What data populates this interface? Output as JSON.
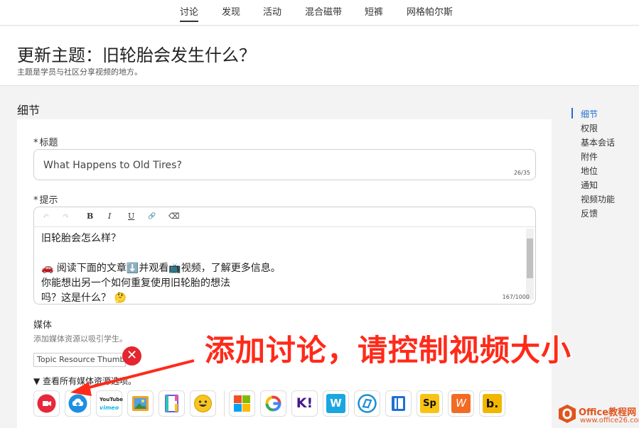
{
  "nav": {
    "tabs": [
      {
        "label": "讨论",
        "active": true
      },
      {
        "label": "发现",
        "active": false
      },
      {
        "label": "活动",
        "active": false
      },
      {
        "label": "混合磁带",
        "active": false
      },
      {
        "label": "短裤",
        "active": false
      },
      {
        "label": "网格帕尔斯",
        "active": false
      }
    ]
  },
  "header": {
    "title": "更新主题：旧轮胎会发生什么？",
    "subtitle": "主题是学员与社区分享视频的地方。"
  },
  "section": {
    "title": "细节"
  },
  "sidenav": {
    "items": [
      {
        "label": "细节",
        "active": true
      },
      {
        "label": "权限"
      },
      {
        "label": "基本会话"
      },
      {
        "label": "附件"
      },
      {
        "label": "地位"
      },
      {
        "label": "通知"
      },
      {
        "label": "视频功能"
      },
      {
        "label": "反馈"
      }
    ]
  },
  "form": {
    "title_label": "标题",
    "required_mark": "*",
    "title_value": "What Happens to Old Tires?",
    "title_count": "26/35",
    "prompt_label": "提示",
    "toolbar": {
      "undo": "↶",
      "redo": "↷",
      "bold": "B",
      "italic": "I",
      "underline": "U",
      "link": "🔗",
      "eraser": "⌫"
    },
    "prompt_lines": [
      "旧轮胎会怎么样？",
      "",
      "🚗 阅读下面的文章⬇️并观看📺视频，了解更多信息。",
      "你能想出另一个如何重复使用旧轮胎的想法",
      "吗？这是什么？ 🤔"
    ],
    "prompt_count": "167/1000",
    "media_label": "媒体",
    "media_hint": "添加媒体资源以吸引学生。",
    "thumbnail_alt": "Topic Resource Thumbnail",
    "remove_glyph": "✕",
    "view_all": "▼ 查看所有媒体资源选项。"
  },
  "media_tools": [
    {
      "name": "record",
      "icon": "record-icon",
      "color": "#e8273b"
    },
    {
      "name": "upload",
      "icon": "upload-cloud-icon",
      "color": "#1d8fe0"
    },
    {
      "name": "youtube-vimeo",
      "icon": "youtube-vimeo-icon",
      "text_top": "YouTube",
      "text_bottom": "vimeo"
    },
    {
      "name": "image",
      "icon": "image-icon",
      "color": "#f2a12c"
    },
    {
      "name": "document",
      "icon": "document-icon",
      "color": "#6b5bd6"
    },
    {
      "name": "emoji",
      "icon": "emoji-icon",
      "color": "#f7c51e"
    },
    {
      "name": "microsoft",
      "icon": "microsoft-icon"
    },
    {
      "name": "google",
      "icon": "google-icon"
    },
    {
      "name": "kahoot",
      "icon": "kahoot-icon",
      "text": "K!",
      "color": "#46178f"
    },
    {
      "name": "wakelet",
      "icon": "wakelet-icon",
      "text": "W",
      "color": "#1aa7e0"
    },
    {
      "name": "nearpod",
      "icon": "nearpod-icon",
      "color": "#1b8ed6"
    },
    {
      "name": "book-creator",
      "icon": "book-icon",
      "color": "#1f6fd1"
    },
    {
      "name": "adobe-spark",
      "icon": "spark-icon",
      "text": "Sp",
      "color": "#f9c313"
    },
    {
      "name": "wevideo",
      "icon": "wevideo-icon",
      "text": "W",
      "color": "#f36b22"
    },
    {
      "name": "buncee",
      "icon": "buncee-icon",
      "text": "b.",
      "color": "#f2b600"
    }
  ],
  "annotation": {
    "text": "添加讨论，请控制视频大小",
    "color": "#ff2a1a"
  },
  "watermark": {
    "brand": "Office教程网",
    "url": "www.office26.com"
  }
}
